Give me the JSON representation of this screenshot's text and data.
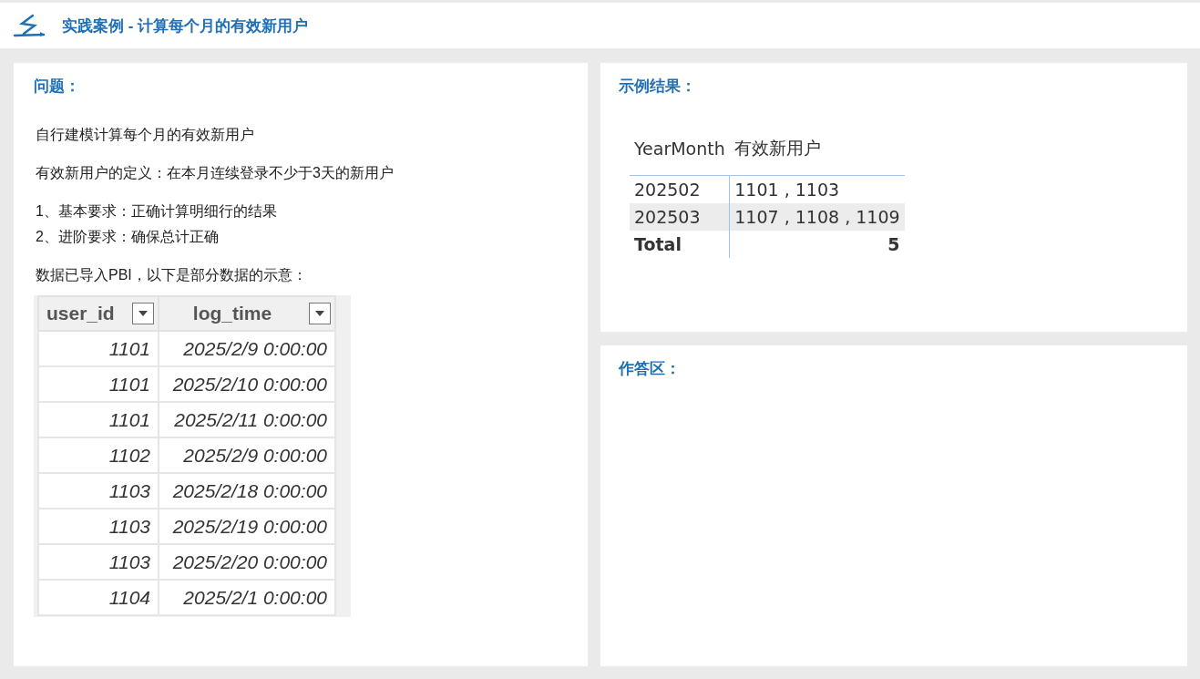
{
  "header": {
    "title": "实践案例 - 计算每个月的有效新用户"
  },
  "problem": {
    "heading": "问题：",
    "paragraph_groups": [
      [
        "自行建模计算每个月的有效新用户"
      ],
      [
        "有效新用户的定义：在本月连续登录不少于3天的新用户"
      ],
      [
        "1、基本要求：正确计算明细行的结果",
        "2、进阶要求：确保总计正确"
      ],
      [
        "数据已导入PBI，以下是部分数据的示意："
      ]
    ],
    "data_table": {
      "columns": [
        "user_id",
        "log_time"
      ],
      "rows": [
        [
          "1101",
          "2025/2/9 0:00:00"
        ],
        [
          "1101",
          "2025/2/10 0:00:00"
        ],
        [
          "1101",
          "2025/2/11 0:00:00"
        ],
        [
          "1102",
          "2025/2/9 0:00:00"
        ],
        [
          "1103",
          "2025/2/18 0:00:00"
        ],
        [
          "1103",
          "2025/2/19 0:00:00"
        ],
        [
          "1103",
          "2025/2/20 0:00:00"
        ],
        [
          "1104",
          "2025/2/1 0:00:00"
        ]
      ]
    }
  },
  "example": {
    "heading": "示例结果：",
    "table": {
      "columns": [
        "YearMonth",
        "有效新用户"
      ],
      "rows": [
        [
          "202502",
          "1101 , 1103"
        ],
        [
          "202503",
          "1107 , 1108 , 1109"
        ]
      ],
      "total": {
        "label": "Total",
        "value": "5"
      }
    }
  },
  "answer": {
    "heading": "作答区："
  }
}
